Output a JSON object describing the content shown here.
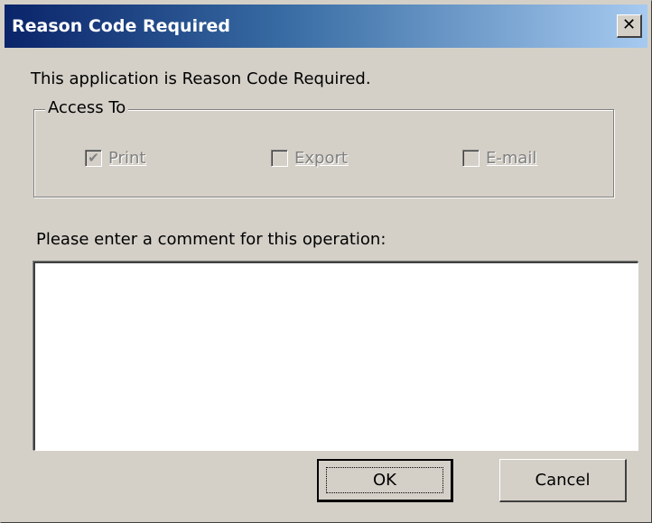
{
  "window": {
    "title": "Reason Code Required",
    "close_glyph": "✕"
  },
  "intro_text": "This application is Reason Code Required.",
  "access_group": {
    "legend": "Access To",
    "options": [
      {
        "label": "Print",
        "checked": true,
        "enabled": false
      },
      {
        "label": "Export",
        "checked": false,
        "enabled": false
      },
      {
        "label": "E-mail",
        "checked": false,
        "enabled": false
      }
    ]
  },
  "comment": {
    "prompt": "Please enter a comment for this operation:",
    "value": ""
  },
  "buttons": {
    "ok_label": "OK",
    "cancel_label": "Cancel"
  },
  "colors": {
    "titlebar_start": "#0a246a",
    "titlebar_end": "#a6caf0",
    "dialog_face": "#d4d0c8"
  }
}
